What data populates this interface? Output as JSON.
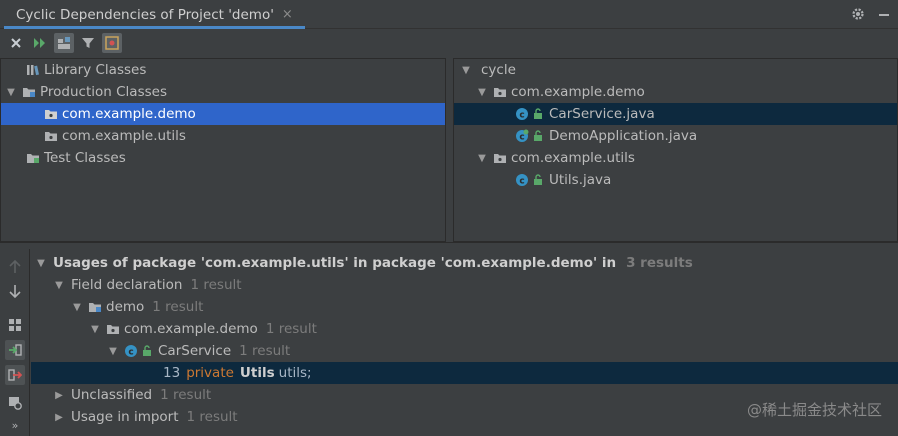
{
  "tab": {
    "title": "Cyclic Dependencies of Project 'demo'",
    "close": "×"
  },
  "left_tree": [
    {
      "label": "Library Classes"
    },
    {
      "label": "Production Classes"
    },
    {
      "label": "com.example.demo"
    },
    {
      "label": "com.example.utils"
    },
    {
      "label": "Test Classes"
    }
  ],
  "right_tree": [
    {
      "label": "cycle"
    },
    {
      "label": "com.example.demo"
    },
    {
      "label": "CarService.java"
    },
    {
      "label": "DemoApplication.java"
    },
    {
      "label": "com.example.utils"
    },
    {
      "label": "Utils.java"
    }
  ],
  "usages": {
    "header": "Usages of package 'com.example.utils' in package 'com.example.demo' in",
    "header_count": "3 results",
    "field_decl": {
      "label": "Field declaration",
      "count": "1 result"
    },
    "demo": {
      "label": "demo",
      "count": "1 result"
    },
    "pkg": {
      "label": "com.example.demo",
      "count": "1 result"
    },
    "carservice": {
      "label": "CarService",
      "count": "1 result"
    },
    "code": {
      "line": "13",
      "kw": "private",
      "type": "Utils",
      "rest": "utils;"
    },
    "unclassified": {
      "label": "Unclassified",
      "count": "1 result"
    },
    "import": {
      "label": "Usage in import",
      "count": "1 result"
    }
  },
  "watermark": "@稀土掘金技术社区",
  "colors": {
    "selection": "#2f65ca",
    "highlight": "#0d293e",
    "accent": "#4a88c7",
    "keyword": "#cc7832"
  }
}
